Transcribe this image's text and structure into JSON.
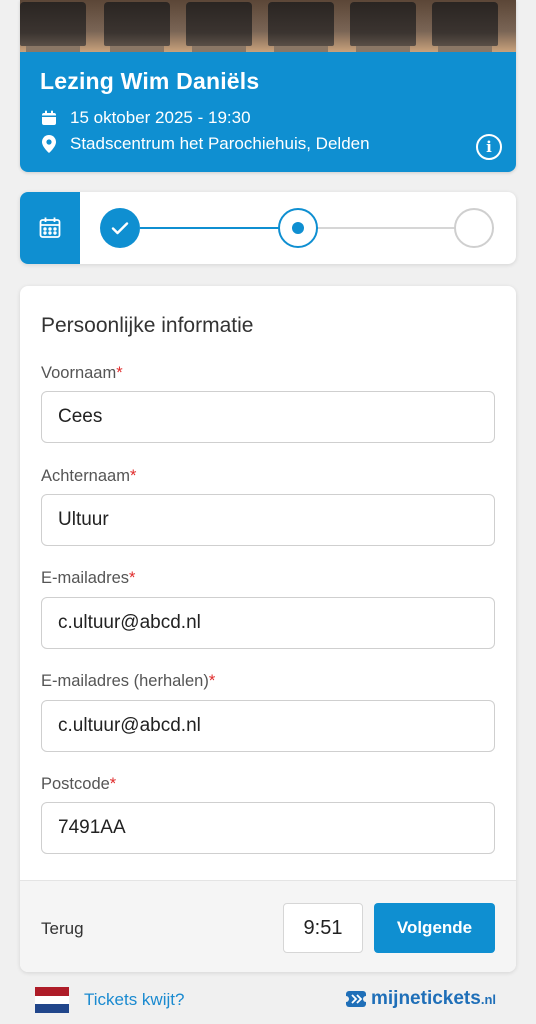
{
  "event": {
    "title": "Lezing Wim Daniëls",
    "datetime": "15 oktober 2025 - 19:30",
    "location": "Stadscentrum het Parochiehuis, Delden",
    "info_icon": "info-icon"
  },
  "progress": {
    "steps": [
      {
        "state": "completed"
      },
      {
        "state": "current"
      },
      {
        "state": "upcoming"
      }
    ]
  },
  "form": {
    "heading": "Persoonlijke informatie",
    "fields": [
      {
        "label": "Voornaam",
        "required_mark": "*",
        "value": "Cees"
      },
      {
        "label": "Achternaam",
        "required_mark": "*",
        "value": "Ultuur"
      },
      {
        "label": "E-mailadres",
        "required_mark": "*",
        "value": "c.ultuur@abcd.nl"
      },
      {
        "label": "E-mailadres (herhalen)",
        "required_mark": "*",
        "value": "c.ultuur@abcd.nl"
      },
      {
        "label": "Postcode",
        "required_mark": "*",
        "value": "7491AA"
      }
    ],
    "back_label": "Terug",
    "timer": "9:51",
    "next_label": "Volgende"
  },
  "footer": {
    "lost_tickets": "Tickets kwijt?",
    "brand": "mijnetickets",
    "brand_suffix": ".nl"
  },
  "colors": {
    "accent": "#0f8fd1",
    "required": "#e02b2b",
    "link": "#1a8ad0",
    "brand": "#1f6fb8"
  }
}
